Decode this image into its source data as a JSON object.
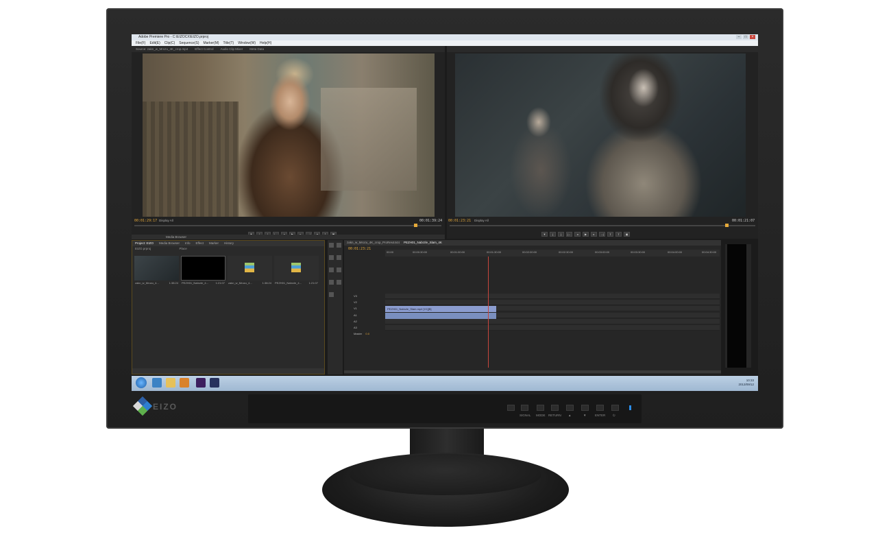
{
  "app": {
    "window_title": "Adobe Premiere Pro - C:\\EIZOCX\\EIZO.prproj",
    "menus": [
      "File(F)",
      "Edit(E)",
      "Clip(C)",
      "Sequence(S)",
      "Marker(M)",
      "Title(T)",
      "Window(W)",
      "Help(H)"
    ]
  },
  "source_monitor": {
    "tabs": [
      "Source: zakn_w_Mrozu_4K_crop.mp4",
      "Effect Control",
      "Audio Clip Mixer",
      "Meta Data"
    ],
    "timecode_in": "00:01:29:17",
    "fit": "Display All",
    "timecode_out": "00:01:39:24"
  },
  "program_monitor": {
    "timecode_in": "00:01:23:21",
    "fit": "Display All",
    "timecode_out": "00:01:21:07"
  },
  "project_panel": {
    "tabs": [
      "Project: EIZO",
      "Media Browser",
      "Info",
      "Effect",
      "Marker",
      "History"
    ],
    "project_file": "EIZO.prproj",
    "search_label": "Place",
    "items": [
      {
        "name": "zakn_w_Mrozu_4...",
        "duration": "1:38:24"
      },
      {
        "name": "PEZH01_Nabrzle_4...",
        "duration": "1:21:07"
      },
      {
        "name": "zakn_w_Mrozu_4...",
        "duration": "1:38:24"
      },
      {
        "name": "PEZH01_Nabrzle_4...",
        "duration": "1:21:07"
      }
    ],
    "tab_media_browser": "Media Browser"
  },
  "timeline": {
    "tabs": [
      "zakn_w_Mrozu_4K_crop_ProRes4444",
      "PEZH01_Nabrzle_Slam_4K"
    ],
    "timecode": "00:01:23:21",
    "ruler": [
      "00:00",
      "00:00:30:00",
      "00:01:00:00",
      "00:01:30:00",
      "00:02:00:00",
      "00:02:30:00",
      "00:03:00:00",
      "00:03:30:00",
      "00:04:00:00",
      "00:04:30:00"
    ],
    "tracks": [
      "V3",
      "V2",
      "V1",
      "A1",
      "A2",
      "A3",
      "Master"
    ],
    "master_value": "0.0",
    "clip_label": "PEZH01_Nabrzle_Slam.mp4 [V1][B]"
  },
  "taskbar": {
    "time": "10:33",
    "date": "2013/09/12"
  },
  "monitor": {
    "brand": "EIZO",
    "buttons": [
      "SIGNAL",
      "MODE",
      "RETURN",
      "▲",
      "▼",
      "ENTER",
      "⏻"
    ]
  },
  "colors": {
    "accent_timecode": "#e5a93a",
    "playhead": "#c9463d",
    "clip_video": "#8b9ccf",
    "power_led": "#2b8ce8"
  }
}
